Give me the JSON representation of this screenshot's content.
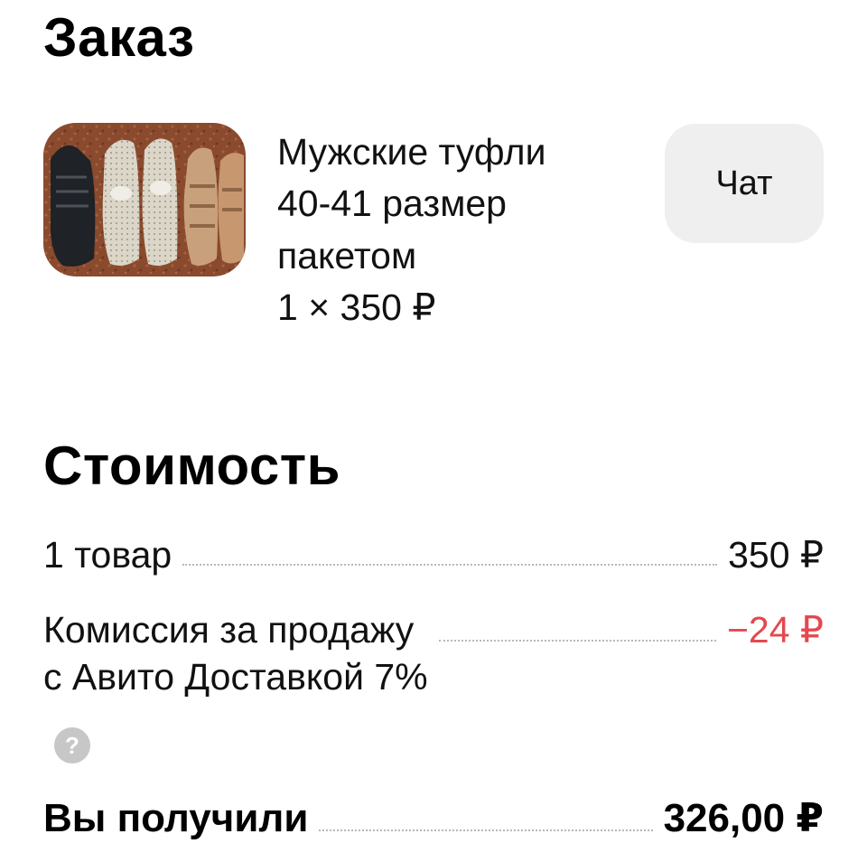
{
  "order": {
    "title": "Заказ",
    "product": {
      "image_alt": "shoes-photo",
      "name_lines": [
        "Мужские туфли",
        "40-41 размер",
        "пакетом"
      ],
      "quantity_price": "1 × 350 ₽"
    },
    "chat_label": "Чат"
  },
  "cost": {
    "title": "Стоимость",
    "items": {
      "label": "1 товар",
      "value": "350 ₽"
    },
    "commission": {
      "label_lines": [
        "Комиссия за продажу",
        "с Авито Доставкой 7%"
      ],
      "value": "−24 ₽"
    },
    "help_icon": "question-icon",
    "help_glyph": "?",
    "total": {
      "label": "Вы получили",
      "value": "326,00 ₽"
    }
  },
  "colors": {
    "negative": "#e5484d",
    "chat_bg": "#efefef",
    "help_icon_bg": "#c7c7c7"
  }
}
